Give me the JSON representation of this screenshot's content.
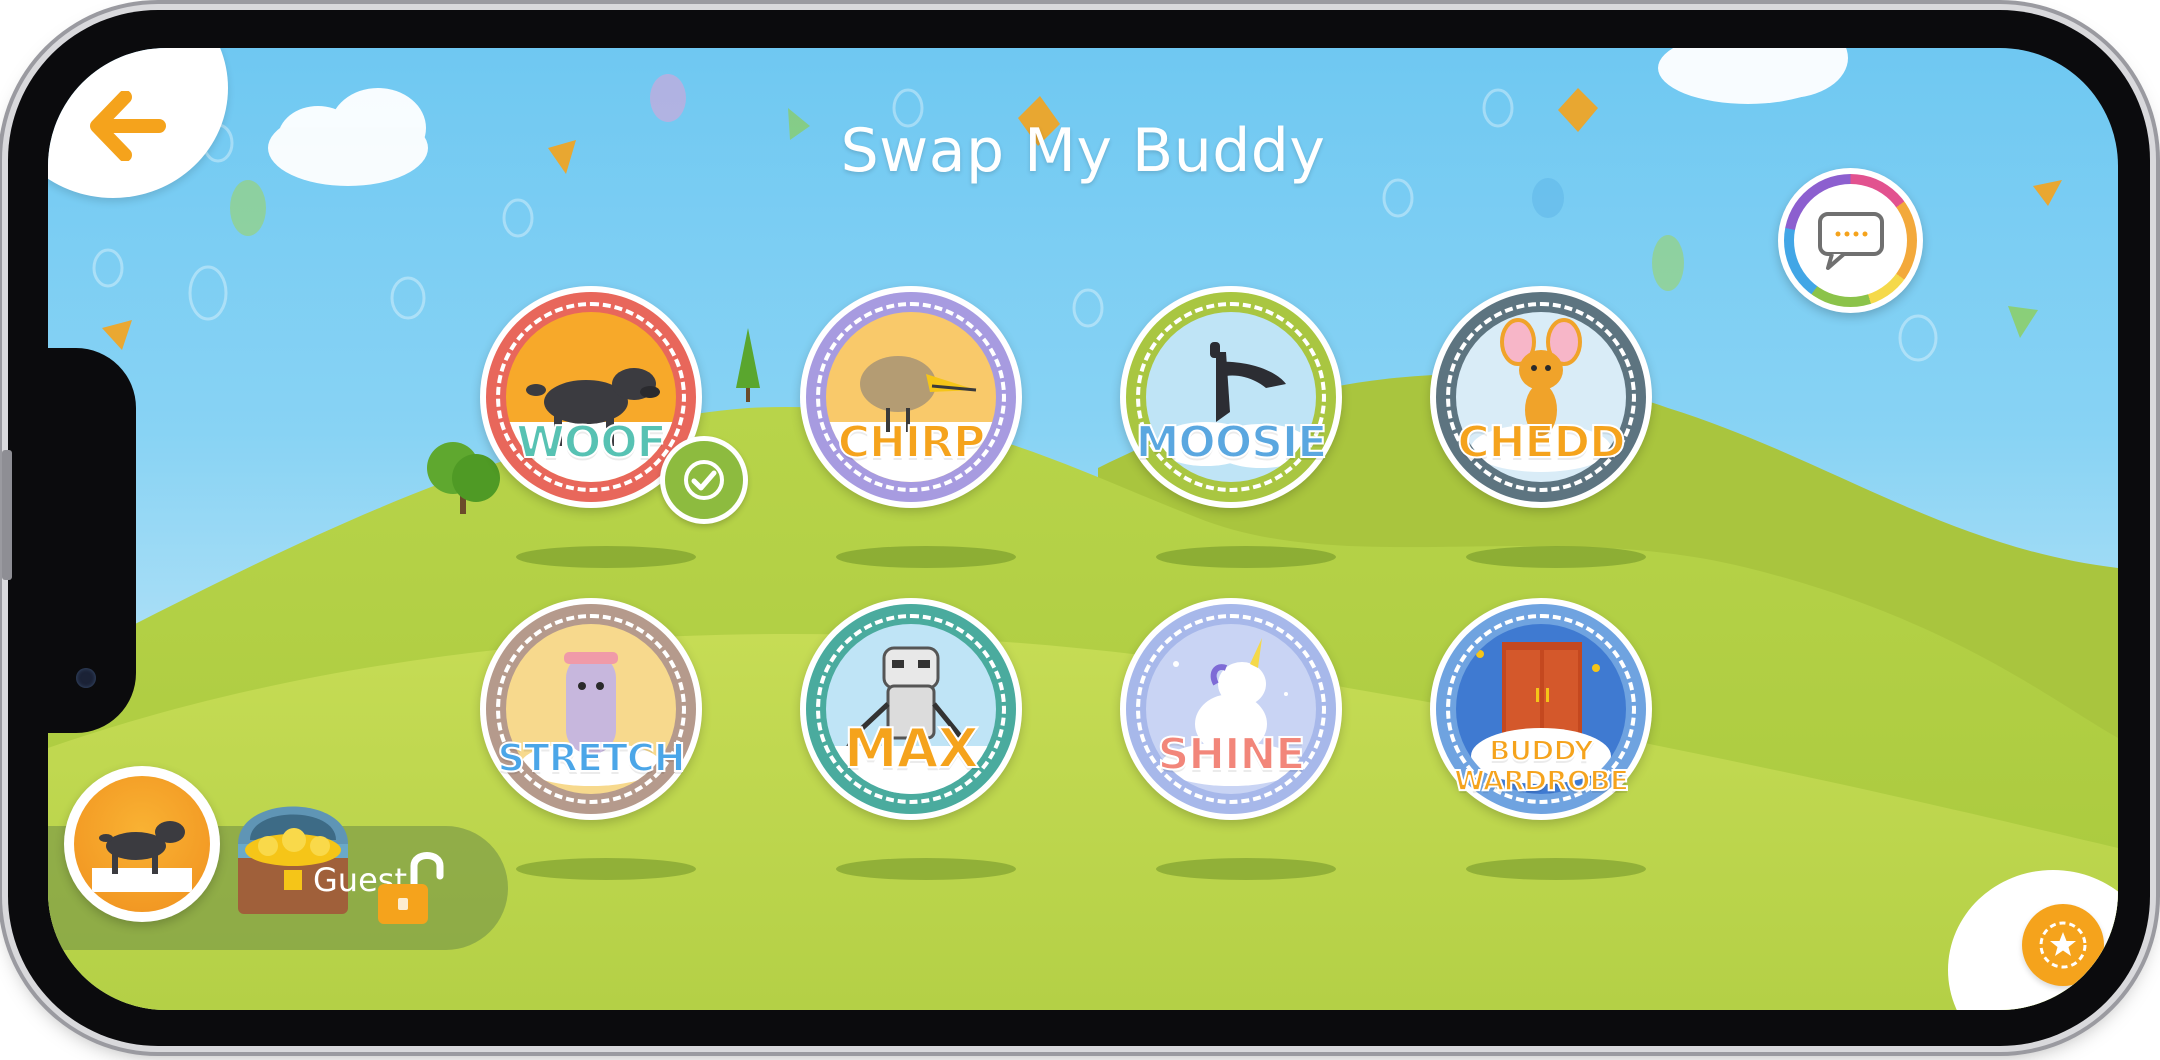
{
  "screen": {
    "title": "Swap My Buddy"
  },
  "buddies": [
    {
      "name": "WOOF",
      "ring_color": "#e8675b",
      "label_color": "#57c2b3",
      "bg_color": "#f7a92a",
      "selected": true
    },
    {
      "name": "CHIRP",
      "ring_color": "#a79be0",
      "label_color": "#f5a31c",
      "bg_color": "#f9c96a",
      "selected": false
    },
    {
      "name": "MOOSIE",
      "ring_color": "#a9c641",
      "label_color": "#5aa7e0",
      "bg_color": "#bfe4f6",
      "selected": false
    },
    {
      "name": "CHEDD",
      "ring_color": "#5d7480",
      "label_color": "#f5a31c",
      "bg_color": "#d9ecf7",
      "selected": false
    },
    {
      "name": "STRETCH",
      "ring_color": "#b59a8c",
      "label_color": "#4ba6e8",
      "bg_color": "#f7d98d",
      "selected": false
    },
    {
      "name": "MAX",
      "ring_color": "#4aab9e",
      "label_color": "#f5a31c",
      "bg_color": "#bfe4f6",
      "selected": false
    },
    {
      "name": "SHINE",
      "ring_color": "#a7b8ea",
      "label_color": "#f2867a",
      "bg_color": "#c9d4f4",
      "selected": false
    },
    {
      "name": "BUDDY WARDROBE",
      "label_line1": "BUDDY",
      "label_line2": "WARDROBE",
      "ring_color": "#6fa3e0",
      "label_color": "#f5a31c",
      "bg_color": "#3f7ad1",
      "selected": false
    }
  ],
  "profile": {
    "user_label": "Guest"
  },
  "icons": {
    "back": "arrow-left-icon",
    "chat": "speech-bubble-icon",
    "selected": "checkmark-icon",
    "lock": "unlocked-padlock-icon",
    "treasure": "treasure-chest-icon",
    "bottom_right": "star-badge-icon"
  },
  "colors": {
    "accent_orange": "#f5a31c",
    "grass": "#b5d34a",
    "sky": "#78cdf2"
  }
}
